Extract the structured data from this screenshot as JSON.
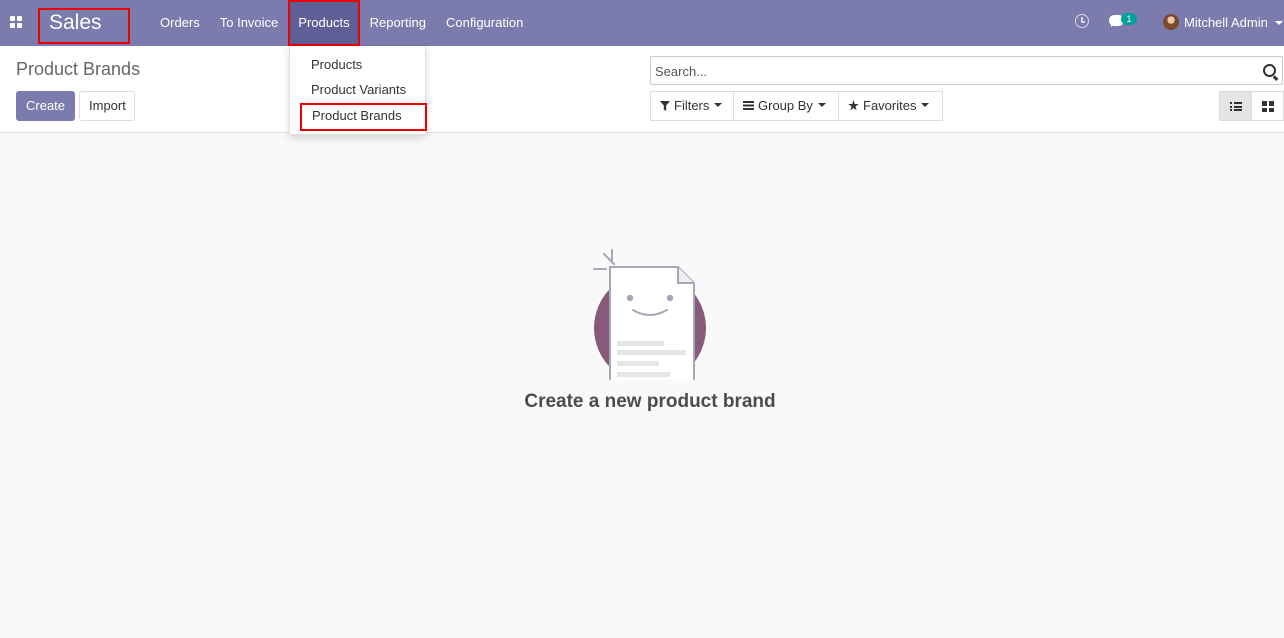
{
  "navbar": {
    "app_name": "Sales",
    "menu": [
      {
        "label": "Orders"
      },
      {
        "label": "To Invoice"
      },
      {
        "label": "Products"
      },
      {
        "label": "Reporting"
      },
      {
        "label": "Configuration"
      }
    ],
    "active_menu": "Products",
    "chat_badge": "1",
    "user_name": "Mitchell Admin",
    "accent_color": "#7c7bad"
  },
  "products_dropdown": {
    "items": [
      {
        "label": "Products"
      },
      {
        "label": "Product Variants"
      },
      {
        "label": "Product Brands"
      }
    ]
  },
  "control_panel": {
    "title": "Product Brands",
    "create_label": "Create",
    "import_label": "Import",
    "search_placeholder": "Search...",
    "filters_label": "Filters",
    "group_by_label": "Group By",
    "favorites_label": "Favorites",
    "active_view": "list"
  },
  "empty_state": {
    "message": "Create a new product brand"
  }
}
